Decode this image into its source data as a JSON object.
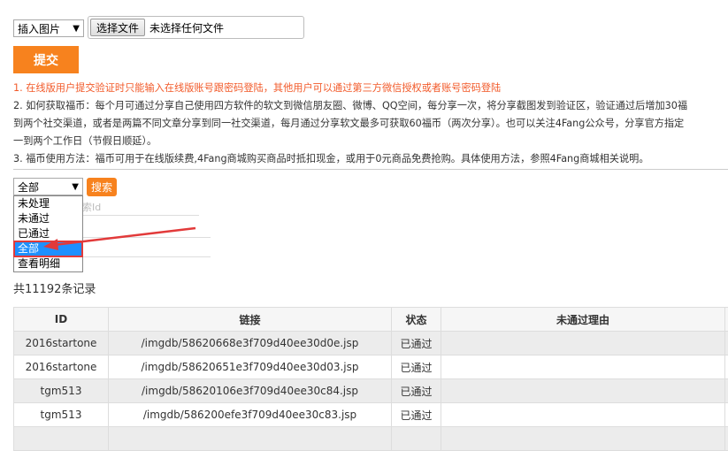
{
  "toolbar": {
    "insert_select": "插入图片",
    "file_button": "选择文件",
    "file_status": "未选择任何文件",
    "submit_label": "提交"
  },
  "notes": {
    "line1": "1. 在线版用户提交验证时只能输入在线版账号跟密码登陆，其他用户可以通过第三方微信授权或者账号密码登陆",
    "line2a": "2. 如何获取福币：每个月可通过分享自己使用四方软件的软文到微信朋友圈、微博、QQ空间，每分享一次，将分享截图发到验证区，验证通过后增加30福",
    "line2b": "到两个社交渠道，或者是两篇不同文章分享到同一社交渠道，每月通过分享软文最多可获取60福币（两次分享）。也可以关注4Fang公众号，分享官方指定",
    "line2c": "一到两个工作日（节假日顺延）。",
    "line3": "3. 福币使用方法：福币可用于在线版续费,4Fang商城购买商品时抵扣现金，或用于0元商品免费抢购。具体使用方法，参照4Fang商城相关说明。"
  },
  "filter": {
    "status_selected": "全部",
    "search_label": "搜索",
    "search_placeholder_visible": "索Id",
    "options": [
      "未处理",
      "未通过",
      "已通过",
      "全部",
      "查看明细"
    ]
  },
  "summary": "共11192条记录",
  "table": {
    "headers": [
      "ID",
      "链接",
      "状态",
      "未通过理由"
    ],
    "rows": [
      [
        "2016startone",
        "/imgdb/58620668e3f709d40ee30d0e.jsp",
        "已通过",
        ""
      ],
      [
        "2016startone",
        "/imgdb/58620651e3f709d40ee30d03.jsp",
        "已通过",
        ""
      ],
      [
        "tgm513",
        "/imgdb/58620106e3f709d40ee30c84.jsp",
        "已通过",
        ""
      ],
      [
        "tgm513",
        "/imgdb/586200efe3f709d40ee30c83.jsp",
        "已通过",
        ""
      ]
    ]
  },
  "colors": {
    "accent": "#f7821e",
    "notice_red": "#f25a2a",
    "highlight": "#1e90ff",
    "annotation": "#e23a3a"
  }
}
